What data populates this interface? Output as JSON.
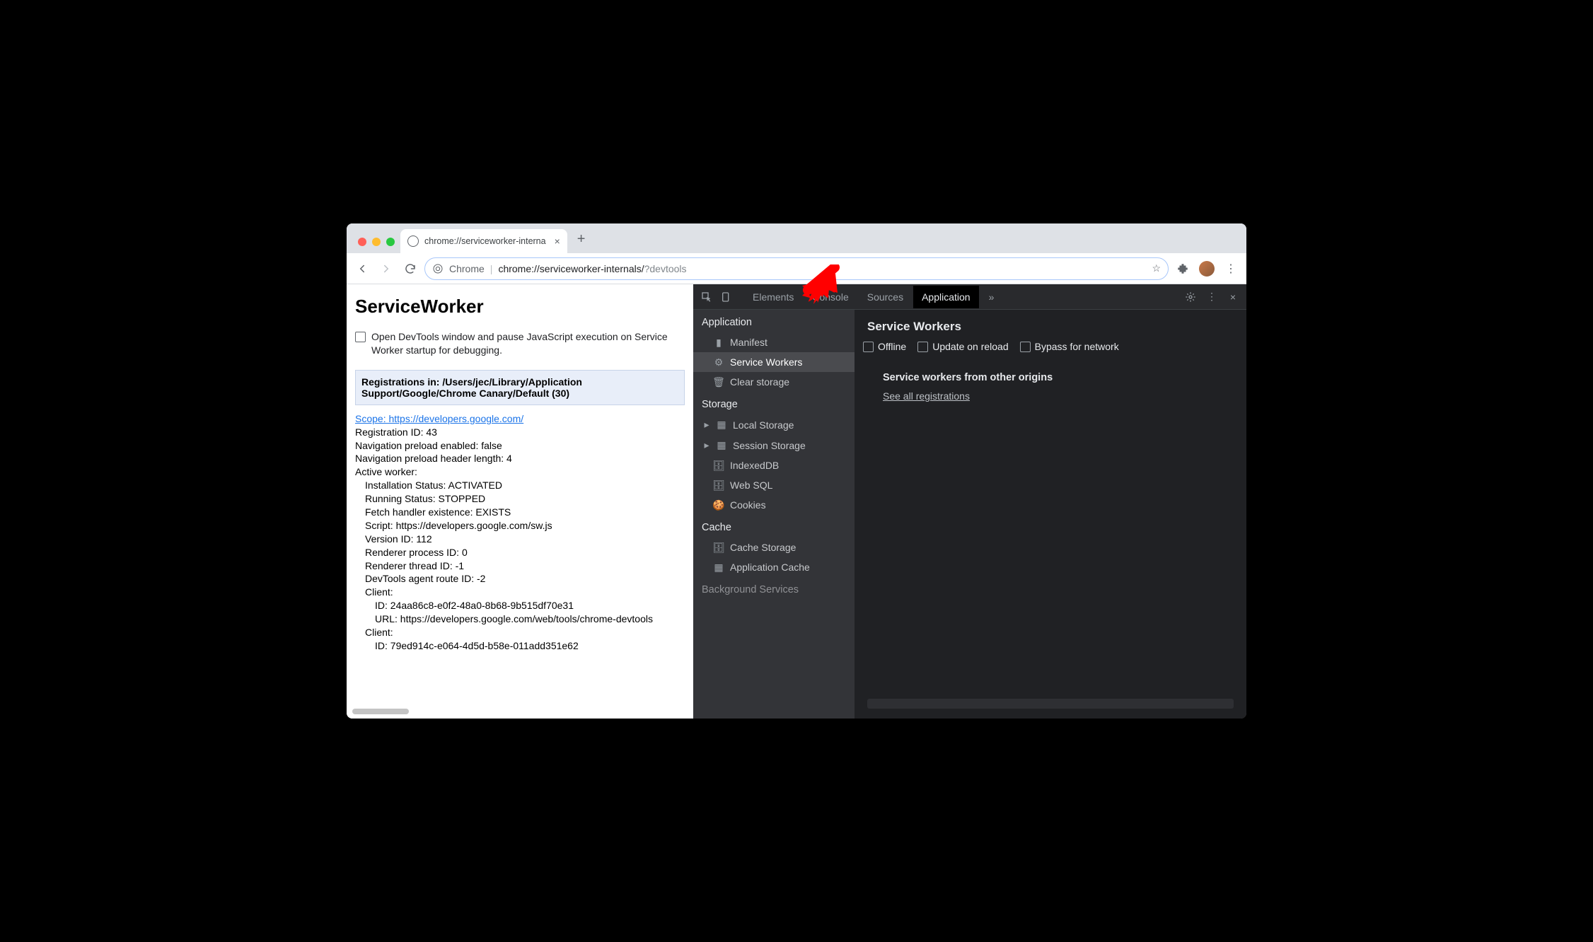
{
  "tab": {
    "title": "chrome://serviceworker-interna"
  },
  "omnibox": {
    "label": "Chrome",
    "path_black": "chrome://serviceworker-internals/",
    "path_grey": "?devtools"
  },
  "page": {
    "heading": "ServiceWorker",
    "debug_checkbox_label": "Open DevTools window and pause JavaScript execution on Service Worker startup for debugging.",
    "registrations_header": "Registrations in: /Users/jec/Library/Application Support/Google/Chrome Canary/Default (30)",
    "scope_label": "Scope: https://developers.google.com/",
    "lines": [
      "Registration ID: 43",
      "Navigation preload enabled: false",
      "Navigation preload header length: 4",
      "Active worker:"
    ],
    "worker_lines": [
      "Installation Status: ACTIVATED",
      "Running Status: STOPPED",
      "Fetch handler existence: EXISTS",
      "Script: https://developers.google.com/sw.js",
      "Version ID: 112",
      "Renderer process ID: 0",
      "Renderer thread ID: -1",
      "DevTools agent route ID: -2",
      "Client:"
    ],
    "client1": [
      "ID: 24aa86c8-e0f2-48a0-8b68-9b515df70e31",
      "URL: https://developers.google.com/web/tools/chrome-devtools"
    ],
    "client2_header": "Client:",
    "client2": [
      "ID: 79ed914c-e064-4d5d-b58e-011add351e62"
    ]
  },
  "devtools": {
    "tabs": [
      "Elements",
      "Console",
      "Sources",
      "Application"
    ],
    "active_tab": "Application",
    "sidebar": {
      "application": {
        "title": "Application",
        "items": [
          "Manifest",
          "Service Workers",
          "Clear storage"
        ]
      },
      "storage": {
        "title": "Storage",
        "items": [
          "Local Storage",
          "Session Storage",
          "IndexedDB",
          "Web SQL",
          "Cookies"
        ]
      },
      "cache": {
        "title": "Cache",
        "items": [
          "Cache Storage",
          "Application Cache"
        ]
      },
      "bg": {
        "title": "Background Services"
      }
    },
    "sw_panel": {
      "title": "Service Workers",
      "checks": [
        "Offline",
        "Update on reload",
        "Bypass for network"
      ],
      "other_title": "Service workers from other origins",
      "link": "See all registrations"
    }
  }
}
